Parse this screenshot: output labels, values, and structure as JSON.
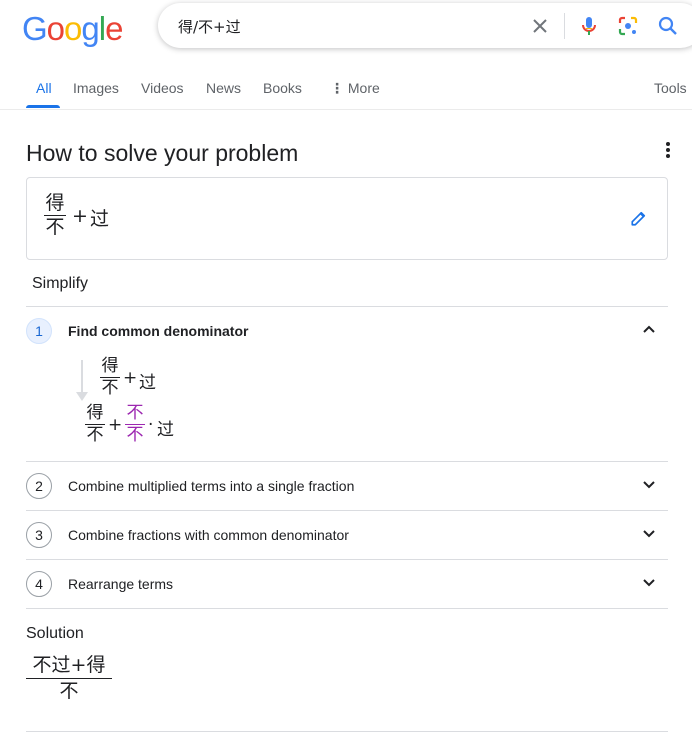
{
  "logo": {
    "letters": [
      "G",
      "o",
      "o",
      "g",
      "l",
      "e"
    ],
    "colors": [
      "#4285F4",
      "#EA4335",
      "#FBBC05",
      "#4285F4",
      "#34A853",
      "#EA4335"
    ]
  },
  "search": {
    "query": "得/不+过",
    "icons": [
      "clear-icon",
      "mic-icon",
      "lens-icon",
      "search-icon"
    ]
  },
  "tabs": [
    {
      "label": "All",
      "active": true
    },
    {
      "label": "Images"
    },
    {
      "label": "Videos"
    },
    {
      "label": "News"
    },
    {
      "label": "Books"
    },
    {
      "label": "More"
    }
  ],
  "tools_label": "Tools",
  "card": {
    "title": "How to solve your problem",
    "input": {
      "numerator": "得",
      "denominator": "不",
      "plus": "+",
      "term": "过"
    },
    "mode": "Simplify"
  },
  "steps": [
    {
      "number": "1",
      "label": "Find common denominator",
      "expanded": true,
      "from": {
        "numerator": "得",
        "denominator": "不",
        "plus": "+",
        "term": "过"
      },
      "to": {
        "numerator": "得",
        "denominator": "不",
        "plus": "+",
        "mult_numerator": "不",
        "mult_denominator": "不",
        "dot": "·",
        "term": "过"
      }
    },
    {
      "number": "2",
      "label": "Combine multiplied terms into a single fraction",
      "expanded": false
    },
    {
      "number": "3",
      "label": "Combine fractions with common denominator",
      "expanded": false
    },
    {
      "number": "4",
      "label": "Rearrange terms",
      "expanded": false
    }
  ],
  "solution": {
    "label": "Solution",
    "numerator": "不过+得",
    "denominator": "不"
  },
  "colors": {
    "accent": "#1a73e8",
    "highlight": "#9c27b0"
  }
}
